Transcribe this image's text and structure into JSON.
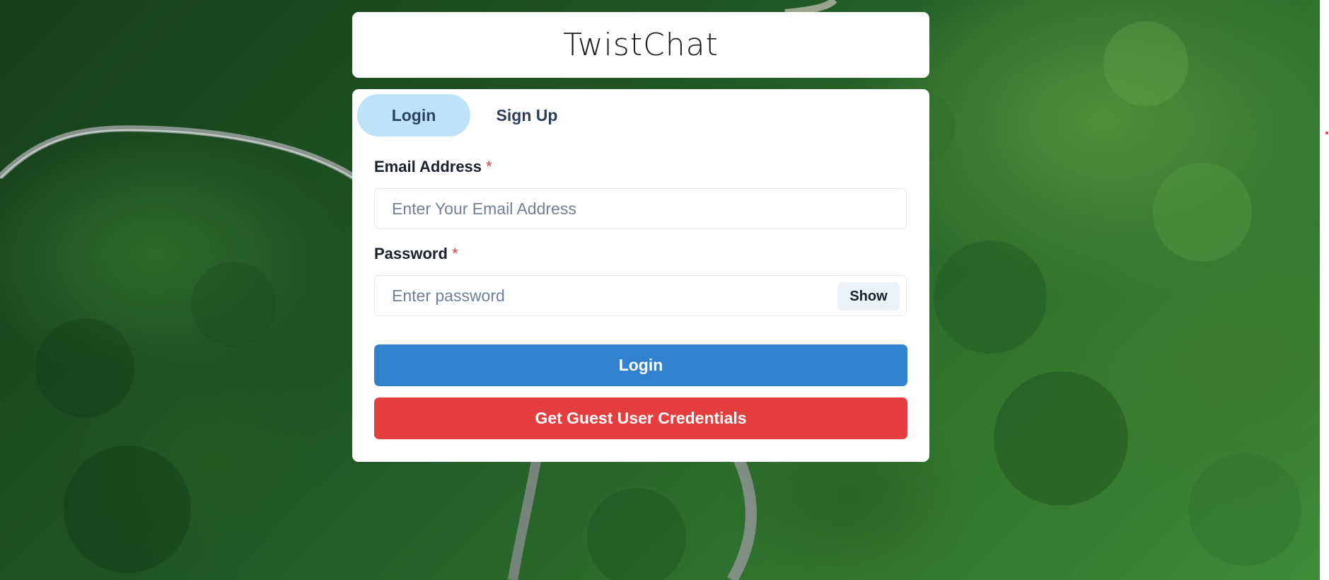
{
  "app": {
    "title": "TwistChat"
  },
  "tabs": [
    {
      "label": "Login",
      "active": true
    },
    {
      "label": "Sign Up",
      "active": false
    }
  ],
  "form": {
    "email": {
      "label": "Email Address",
      "required_mark": "*",
      "placeholder": "Enter Your Email Address",
      "value": ""
    },
    "password": {
      "label": "Password",
      "required_mark": "*",
      "placeholder": "Enter password",
      "value": "",
      "toggle_label": "Show"
    },
    "login_button": "Login",
    "guest_button": "Get Guest User Credentials"
  },
  "colors": {
    "primary": "#3182ce",
    "danger": "#e53e3e",
    "active_tab": "#bee3f8",
    "background_foliage": "#2a6a2b"
  }
}
